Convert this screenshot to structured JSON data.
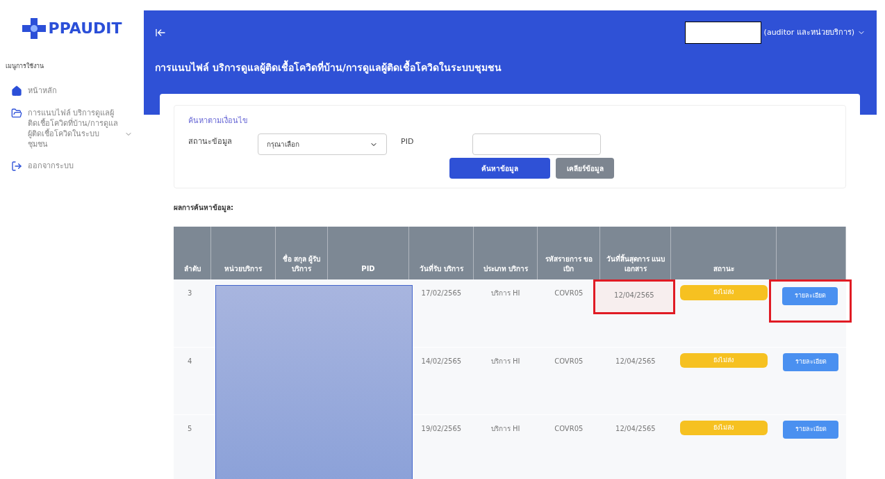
{
  "sidebar": {
    "logo": "PPAUDIT",
    "menu_heading": "เมนูการใช้งาน",
    "items": [
      {
        "kind": "home",
        "label": "หน้าหลัก",
        "expandable": false
      },
      {
        "kind": "folder",
        "label": "การแนบไฟล์ บริการดูแลผู้ติดเชื้อโควิดที่บ้าน/การดูแลผู้ติดเชื้อโควิดในระบบชุมชน",
        "expandable": true
      },
      {
        "kind": "logout",
        "label": "ออกจากระบบ",
        "expandable": false
      }
    ]
  },
  "header": {
    "user_role": "(auditor และหน่วยบริการ)",
    "page_title": "การแนบไฟล์ บริการดูแลผู้ติดเชื้อโควิดที่บ้าน/การดูแลผู้ติดเชื้อโควิดในระบบชุมชน"
  },
  "search": {
    "legend": "ค้นหาตามเงื่อนไข",
    "status_label": "สถานะข้อมูล",
    "status_select": "กรุณาเลือก",
    "pid_label": "PID",
    "buttons": [
      {
        "kind": "primary",
        "label": "ค้นหาข้อมูล"
      },
      {
        "kind": "secondary",
        "label": "เคลียร์ข้อมูล"
      }
    ]
  },
  "results_label": "ผลการค้นหาข้อมูล:",
  "table": {
    "columns": [
      "ลำดับ",
      "หน่วยบริการ",
      "ชื่อ สกุล ผู้รับ บริการ",
      "PID",
      "วันที่รับ บริการ",
      "ประเภท บริการ",
      "รหัสรายการ ขอเบิก",
      "วันที่สิ้นสุดการ แนบเอกสาร",
      "สถานะ"
    ],
    "rows": [
      {
        "no": "3",
        "service_date": "17/02/2565",
        "service_type": "บริการ HI",
        "claim_code": "COVR05",
        "deadline": "12/04/2565",
        "status": "ยังไม่ส่ง",
        "action": "รายละเอียด",
        "highlighted": true
      },
      {
        "no": "4",
        "service_date": "14/02/2565",
        "service_type": "บริการ HI",
        "claim_code": "COVR05",
        "deadline": "12/04/2565",
        "status": "ยังไม่ส่ง",
        "action": "รายละเอียด",
        "highlighted": false
      },
      {
        "no": "5",
        "service_date": "19/02/2565",
        "service_type": "บริการ HI",
        "claim_code": "COVR05",
        "deadline": "12/04/2565",
        "status": "ยังไม่ส่ง",
        "action": "รายละเอียด",
        "highlighted": false
      }
    ]
  }
}
